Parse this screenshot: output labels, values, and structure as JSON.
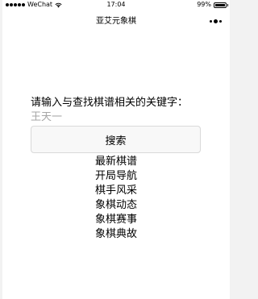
{
  "status_bar": {
    "carrier": "WeChat",
    "time": "17:04",
    "battery": "99%",
    "battery_level": 0.99,
    "signal_bars_on": 5
  },
  "nav": {
    "title": "亚艾元象棋"
  },
  "search": {
    "prompt": "请输入与查找棋谱相关的关键字：",
    "input_value": "王天一",
    "button_label": "搜索"
  },
  "menu": {
    "items": [
      {
        "label": "最新棋谱"
      },
      {
        "label": "开局导航"
      },
      {
        "label": "棋手风采"
      },
      {
        "label": "象棋动态"
      },
      {
        "label": "象棋赛事"
      },
      {
        "label": "象棋典故"
      }
    ]
  },
  "icons": {
    "wifi": "wifi-icon",
    "battery": "battery-icon",
    "more": "more-icon"
  }
}
